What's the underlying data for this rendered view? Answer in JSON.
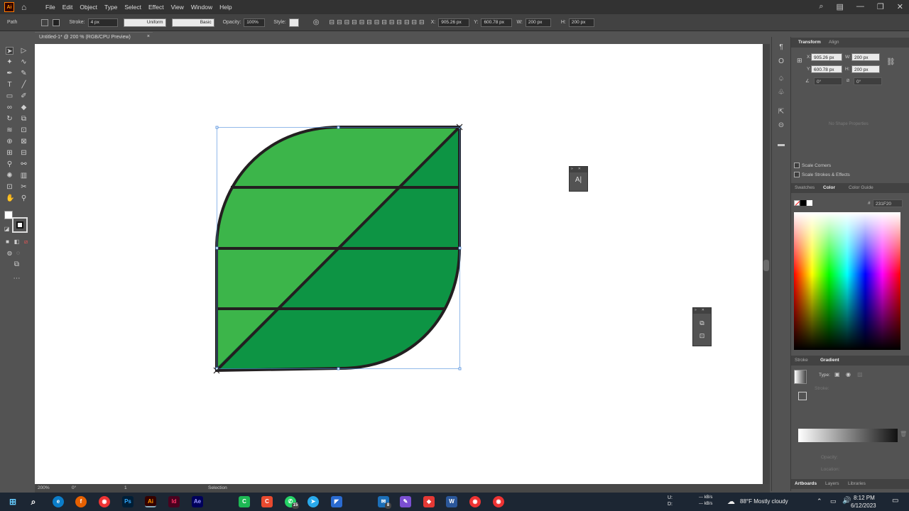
{
  "app": {
    "logo": "Ai",
    "home_icon": "home-icon"
  },
  "menu": [
    "File",
    "Edit",
    "Object",
    "Type",
    "Select",
    "Effect",
    "View",
    "Window",
    "Help"
  ],
  "control_bar": {
    "selection_type": "Path",
    "stroke_label": "Stroke:",
    "stroke_weight": "4 px",
    "variable_width": "Uniform",
    "brush": "Basic",
    "opacity_label": "Opacity:",
    "opacity": "100%",
    "style_label": "Style:",
    "x_label": "X:",
    "x": "905.26 px",
    "y_label": "Y:",
    "y": "600.78 px",
    "w_label": "W:",
    "w": "200 px",
    "h_label": "H:",
    "h": "200 px"
  },
  "document_tab": {
    "title": "Untitled-1* @ 200 % (RGB/CPU Preview)",
    "close": "×"
  },
  "leaf": {
    "fill_light": "#3cb54a",
    "fill_dark": "#0d9444",
    "stroke": "#231f20"
  },
  "status_bar": {
    "zoom": "200%",
    "rotation": "0°",
    "artboard": "1",
    "tool": "Selection"
  },
  "transform_panel": {
    "tabs": [
      "Transform",
      "Align"
    ],
    "x_label": "X:",
    "x": "905.26 px",
    "y_label": "Y:",
    "y": "600.78 px",
    "w_label": "W:",
    "w": "200 px",
    "h_label": "H:",
    "h": "200 px",
    "angle": "0°",
    "shear": "0°",
    "no_shape": "No Shape Properties",
    "scale_corners": "Scale Corners",
    "scale_strokes": "Scale Strokes & Effects"
  },
  "color_panel": {
    "tabs": [
      "Swatches",
      "Color",
      "Color Guide"
    ],
    "hex_prefix": "#",
    "hex": "231F20"
  },
  "gradient_panel": {
    "tabs": [
      "Stroke",
      "Gradient"
    ],
    "type_label": "Type:",
    "stroke_label": "Stroke:",
    "opacity_label": "Opacity:",
    "location_label": "Location:"
  },
  "bottom_tabs": [
    "Artboards",
    "Layers",
    "Libraries"
  ],
  "taskbar": {
    "net_up": "U:",
    "net_down": "D:",
    "net_up_val": "--- kB/s",
    "net_down_val": "--- kB/s",
    "weather": "88°F  Mostly cloudy",
    "time": "8:12 PM",
    "date": "6/12/2023",
    "badges": {
      "whatsapp": "15",
      "mail": "8"
    }
  }
}
